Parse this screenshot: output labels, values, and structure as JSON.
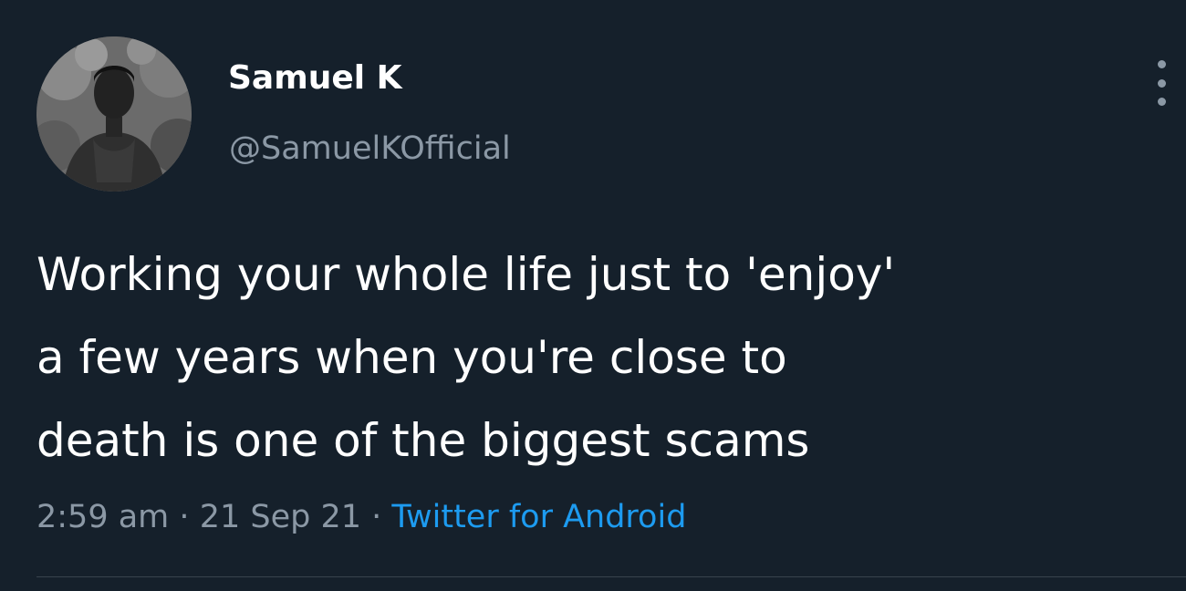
{
  "tweet": {
    "author": {
      "display_name": "Samuel K",
      "handle": "@SamuelKOfficial"
    },
    "text_lines": [
      "Working your whole life just to 'enjoy'",
      "a few years when you're close to",
      "death is one of the biggest scams"
    ],
    "time": "2:59 am",
    "date": "21 Sep 21",
    "separator": "·",
    "source": "Twitter for Android"
  },
  "icons": {
    "more": "more-options-icon",
    "avatar": "profile-avatar"
  },
  "colors": {
    "background": "#15202b",
    "primary_text": "#ffffff",
    "secondary_text": "#8b98a5",
    "accent": "#1d9bf0",
    "divider": "#38444d"
  }
}
